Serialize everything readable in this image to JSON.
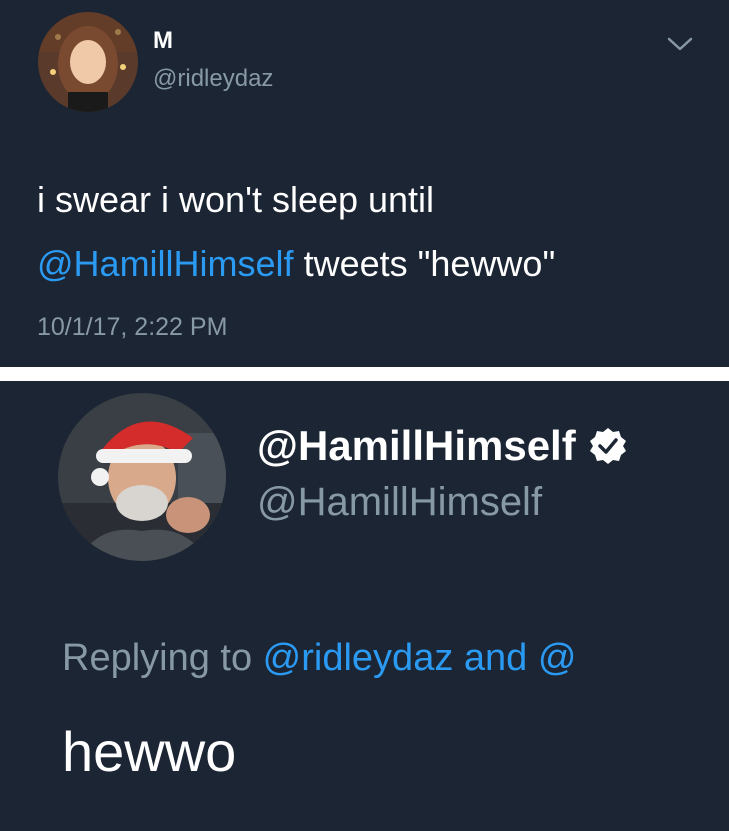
{
  "tweet_top": {
    "display_name": "M",
    "handle": "@ridleydaz",
    "text_line1": "i swear i won't sleep until",
    "text_mention": "@HamillHimself",
    "text_rest": " tweets \"hewwo\"",
    "timestamp": "10/1/17, 2:22 PM",
    "menu_icon": "chevron-down-icon"
  },
  "tweet_bottom": {
    "display_name": "@HamillHimself",
    "handle": "@HamillHimself",
    "verified_icon": "verified-badge-icon",
    "replying_prefix": "Replying to ",
    "replying_mentions": "@ridleydaz and @",
    "text": "hewwo"
  },
  "colors": {
    "background": "#1b2533",
    "text": "#ffffff",
    "secondary": "#8899a6",
    "link": "#2b9af3"
  }
}
